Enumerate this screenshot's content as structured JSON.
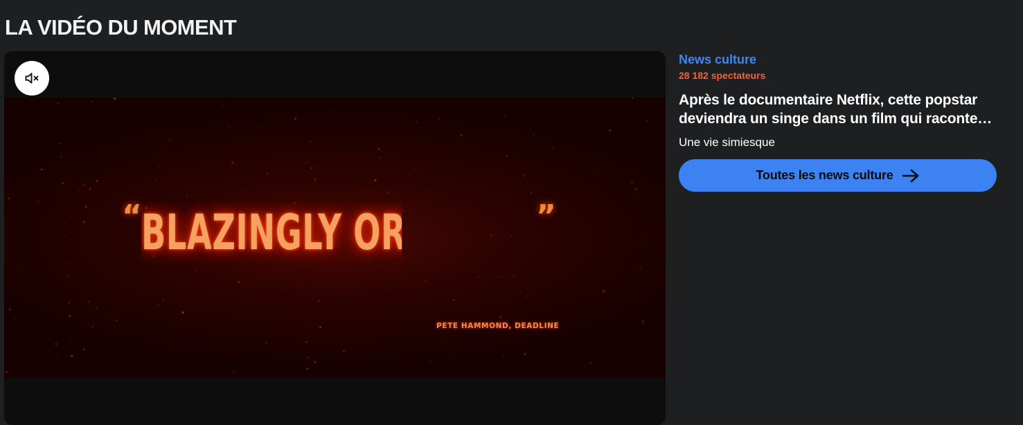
{
  "section": {
    "title": "LA VIDÉO DU MOMENT"
  },
  "player": {
    "mute_icon": "volume-muted-icon",
    "frame": {
      "quote_open": "“",
      "quote_text": "BLAZINGLY ORIGINAL",
      "quote_close": "”",
      "credit": "PETE HAMMOND, DEADLINE"
    }
  },
  "news": {
    "category": "News culture",
    "viewers": "28 182 spectateurs",
    "headline": "Après le documentaire Netflix, cette popstar deviendra un singe dans un film qui raconte…",
    "subtitle": "Une vie simiesque",
    "all_button_label": "Toutes les news culture",
    "all_button_icon": "arrow-right-icon"
  },
  "colors": {
    "background": "#1e1f21",
    "accent_blue": "#3d82f3",
    "viewers_orange": "#f2633a",
    "player_background": "#0d0d0e"
  }
}
